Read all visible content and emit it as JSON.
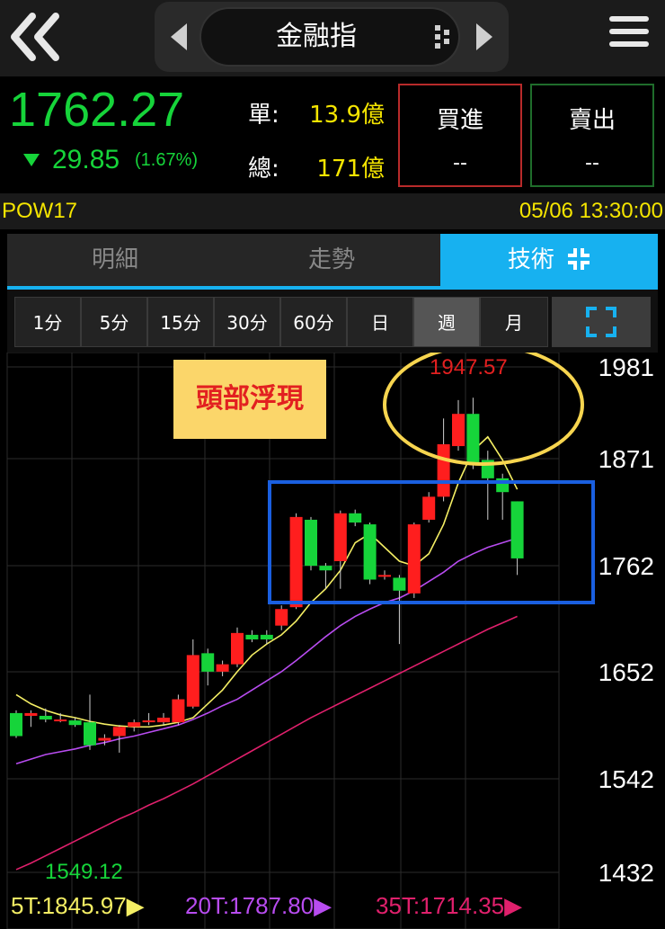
{
  "header": {
    "title": "金融指",
    "back_icon": "double-chevron-left-icon",
    "menu_icon": "hamburger-menu-icon"
  },
  "quote": {
    "price": "1762.27",
    "change": "29.85",
    "change_pct": "(1.67%)",
    "single_label": "單:",
    "single_value": "13.9億",
    "total_label": "總:",
    "total_value": "171億",
    "buy_label": "買進",
    "buy_value": "--",
    "sell_label": "賣出",
    "sell_value": "--"
  },
  "info": {
    "code": "POW17",
    "datetime": "05/06 13:30:00"
  },
  "tabs": [
    {
      "label": "明細"
    },
    {
      "label": "走勢"
    },
    {
      "label": "技術"
    }
  ],
  "periods": [
    "1分",
    "5分",
    "15分",
    "30分",
    "60分",
    "日",
    "週",
    "月"
  ],
  "annotation": {
    "note": "頭部浮現"
  },
  "chart_data": {
    "type": "candlestick",
    "y_ticks": [
      "1981",
      "1871",
      "1762",
      "1652",
      "1542",
      "1432"
    ],
    "peak_label": "1947.57",
    "low_label": "1549.12",
    "candles": [
      {
        "o": 1605,
        "c": 1580,
        "h": 1608,
        "l": 1578
      },
      {
        "o": 1602,
        "c": 1605,
        "h": 1608,
        "l": 1590
      },
      {
        "o": 1602,
        "c": 1598,
        "h": 1610,
        "l": 1595
      },
      {
        "o": 1598,
        "c": 1598,
        "h": 1605,
        "l": 1595
      },
      {
        "o": 1597,
        "c": 1592,
        "h": 1600,
        "l": 1590
      },
      {
        "o": 1595,
        "c": 1570,
        "h": 1625,
        "l": 1565
      },
      {
        "o": 1575,
        "c": 1578,
        "h": 1582,
        "l": 1570
      },
      {
        "o": 1580,
        "c": 1590,
        "h": 1592,
        "l": 1562
      },
      {
        "o": 1590,
        "c": 1595,
        "h": 1598,
        "l": 1585
      },
      {
        "o": 1597,
        "c": 1597,
        "h": 1605,
        "l": 1592
      },
      {
        "o": 1595,
        "c": 1600,
        "h": 1605,
        "l": 1592
      },
      {
        "o": 1595,
        "c": 1620,
        "h": 1625,
        "l": 1592
      },
      {
        "o": 1612,
        "c": 1668,
        "h": 1685,
        "l": 1610
      },
      {
        "o": 1670,
        "c": 1650,
        "h": 1675,
        "l": 1635
      },
      {
        "o": 1650,
        "c": 1658,
        "h": 1662,
        "l": 1645
      },
      {
        "o": 1658,
        "c": 1692,
        "h": 1698,
        "l": 1655
      },
      {
        "o": 1690,
        "c": 1685,
        "h": 1695,
        "l": 1682
      },
      {
        "o": 1690,
        "c": 1685,
        "h": 1695,
        "l": 1680
      },
      {
        "o": 1700,
        "c": 1718,
        "h": 1722,
        "l": 1695
      },
      {
        "o": 1720,
        "c": 1818,
        "h": 1822,
        "l": 1718
      },
      {
        "o": 1815,
        "c": 1765,
        "h": 1818,
        "l": 1760
      },
      {
        "o": 1765,
        "c": 1760,
        "h": 1768,
        "l": 1740
      },
      {
        "o": 1770,
        "c": 1822,
        "h": 1825,
        "l": 1740
      },
      {
        "o": 1822,
        "c": 1812,
        "h": 1826,
        "l": 1808
      },
      {
        "o": 1810,
        "c": 1750,
        "h": 1812,
        "l": 1745
      },
      {
        "o": 1755,
        "c": 1755,
        "h": 1760,
        "l": 1750
      },
      {
        "o": 1752,
        "c": 1738,
        "h": 1755,
        "l": 1680
      },
      {
        "o": 1735,
        "c": 1810,
        "h": 1812,
        "l": 1730
      },
      {
        "o": 1815,
        "c": 1840,
        "h": 1845,
        "l": 1812
      },
      {
        "o": 1840,
        "c": 1897,
        "h": 1925,
        "l": 1835
      },
      {
        "o": 1895,
        "c": 1930,
        "h": 1945,
        "l": 1890
      },
      {
        "o": 1930,
        "c": 1875,
        "h": 1947.57,
        "l": 1870
      },
      {
        "o": 1880,
        "c": 1860,
        "h": 1890,
        "l": 1815
      },
      {
        "o": 1860,
        "c": 1845,
        "h": 1865,
        "l": 1815
      },
      {
        "o": 1835,
        "c": 1773,
        "h": 1835,
        "l": 1755
      }
    ],
    "ma5": [
      1625,
      1615,
      1608,
      1603,
      1600,
      1596,
      1593,
      1591,
      1590,
      1590,
      1592,
      1595,
      1600,
      1615,
      1630,
      1650,
      1668,
      1680,
      1690,
      1705,
      1725,
      1740,
      1760,
      1790,
      1800,
      1785,
      1770,
      1765,
      1778,
      1810,
      1855,
      1890,
      1905,
      1880,
      1848
    ],
    "ma20": [
      1550,
      1555,
      1560,
      1563,
      1566,
      1570,
      1573,
      1577,
      1580,
      1584,
      1588,
      1592,
      1598,
      1605,
      1613,
      1620,
      1630,
      1640,
      1650,
      1662,
      1675,
      1688,
      1700,
      1710,
      1718,
      1725,
      1730,
      1738,
      1748,
      1758,
      1770,
      1778,
      1785,
      1790,
      1795
    ],
    "ma35": [
      1435,
      1442,
      1450,
      1458,
      1466,
      1474,
      1482,
      1490,
      1497,
      1505,
      1512,
      1520,
      1528,
      1537,
      1546,
      1555,
      1564,
      1573,
      1582,
      1591,
      1600,
      1608,
      1616,
      1624,
      1632,
      1640,
      1648,
      1656,
      1664,
      1672,
      1680,
      1688,
      1696,
      1703,
      1710
    ],
    "legend": [
      {
        "label": "5T:1845.97",
        "color": "#f4ee64"
      },
      {
        "label": "20T:1787.80",
        "color": "#b84cf0"
      },
      {
        "label": "35T:1714.35",
        "color": "#e0206c"
      }
    ]
  },
  "colors": {
    "up": "#ff1e1e",
    "down": "#16d43a",
    "accent": "#17b1f0",
    "yellow": "#f5e500"
  }
}
